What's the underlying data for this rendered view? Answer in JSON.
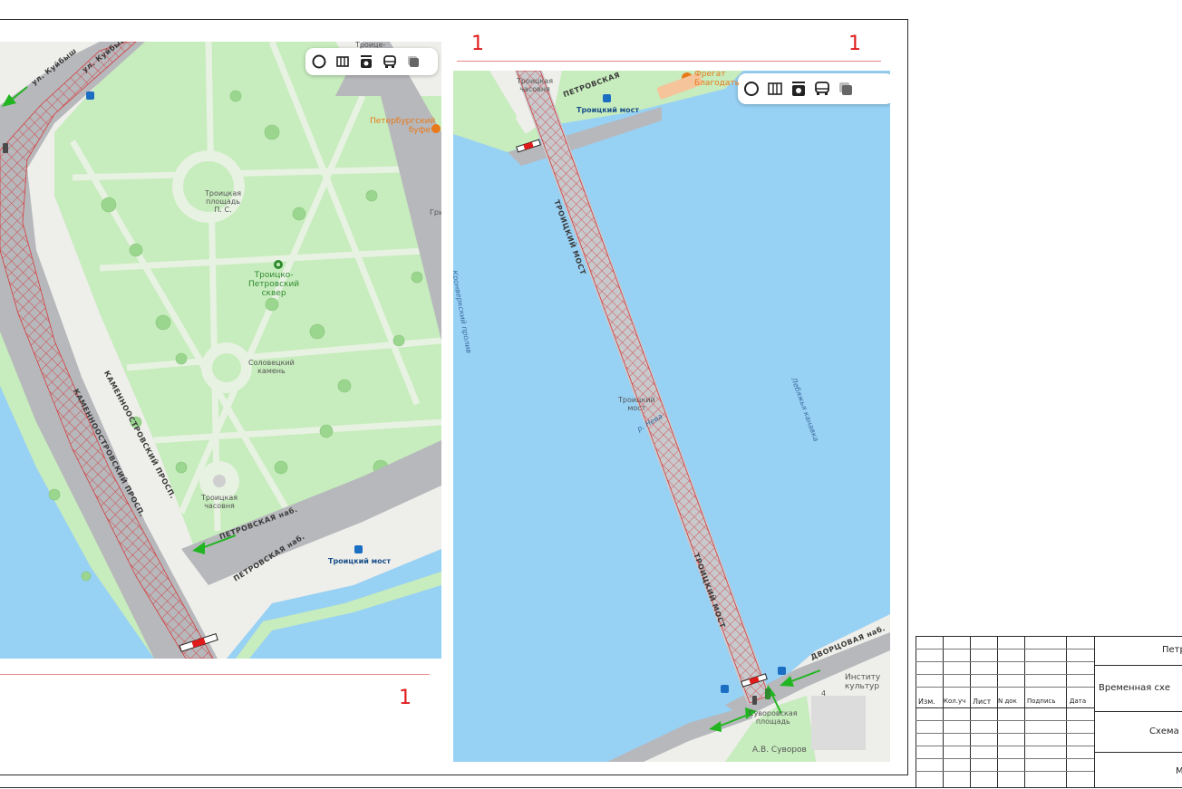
{
  "colors": {
    "water": "#97d1f4",
    "park": "#c7ecbd",
    "park_path": "#e7f2e2",
    "land": "#eeeeea",
    "road": "#b7b8bc",
    "hatch": "#d43c3c",
    "marker_red": "#e01b1b",
    "arrow_green": "#22b522"
  },
  "section_markers": {
    "top_left": "1",
    "top_right": "1",
    "bottom_left": "1"
  },
  "left_map": {
    "toolbar_icons": [
      "panorama-icon",
      "map-layers-icon",
      "camera-icon",
      "bus-icon",
      "layers-icon"
    ],
    "labels": {
      "street_top_1": "ул. Куйбыш",
      "street_top_2": "ул. Куйбыш",
      "trinity_square": "Троицкая\nплощадь\nП. С.",
      "park_name": "Троицко-\nПетровский\nсквер",
      "solovetsky": "Соловецкий\nкамень",
      "chapel": "Троицкая\nчасовня",
      "kamenno_1": "КАМЕННООСТРОВСКИЙ ПРОСП.",
      "kamenno_2": "КАМЕННООСТРОВСКИЙ ПРОСП.",
      "petrovskaya_1": "ПЕТРОВСКАЯ наб.",
      "petrovskaya_2": "ПЕТРОВСКАЯ наб.",
      "trinity_bridge_stop": "Троицкий мост",
      "buffet": "Петербургский\nбуфет",
      "cut_top": "Троице-",
      "cut_right": "Гри"
    }
  },
  "right_map": {
    "toolbar_icons": [
      "panorama-icon",
      "map-layers-icon",
      "camera-icon",
      "bus-icon",
      "layers-icon"
    ],
    "labels": {
      "chapel": "Троицкая\nчасовня",
      "petrovskaya": "ПЕТРОВСКАЯ",
      "bridge_stop": "Троицкий мост",
      "fregat": "Фрегат\nБлагодать",
      "bridge_name_1": "ТРОИЦКИЙ МОСТ",
      "bridge_name_2": "ТРОИЦКИЙ МОСТ",
      "kronverksky": "Кронверкский пролив",
      "lebyazhya": "Лебяжья канавка",
      "bridge_small": "Троицкий\nмост",
      "neva": "р. Нева",
      "dvortsovaya": "ДВОРЦОВАЯ наб.",
      "suvorov_square": "Суворовская\nплощадь",
      "suvorov": "А.В. Суворов",
      "institute": "Институ\nкультур",
      "num_4": "4"
    }
  },
  "title_block": {
    "headers": [
      "Изм.",
      "Кол.уч",
      "Лист",
      "N док",
      "Подпись",
      "Дата"
    ],
    "row1": "Петр",
    "row2": "Временная схе",
    "row3": "Схема",
    "row4": "М"
  }
}
